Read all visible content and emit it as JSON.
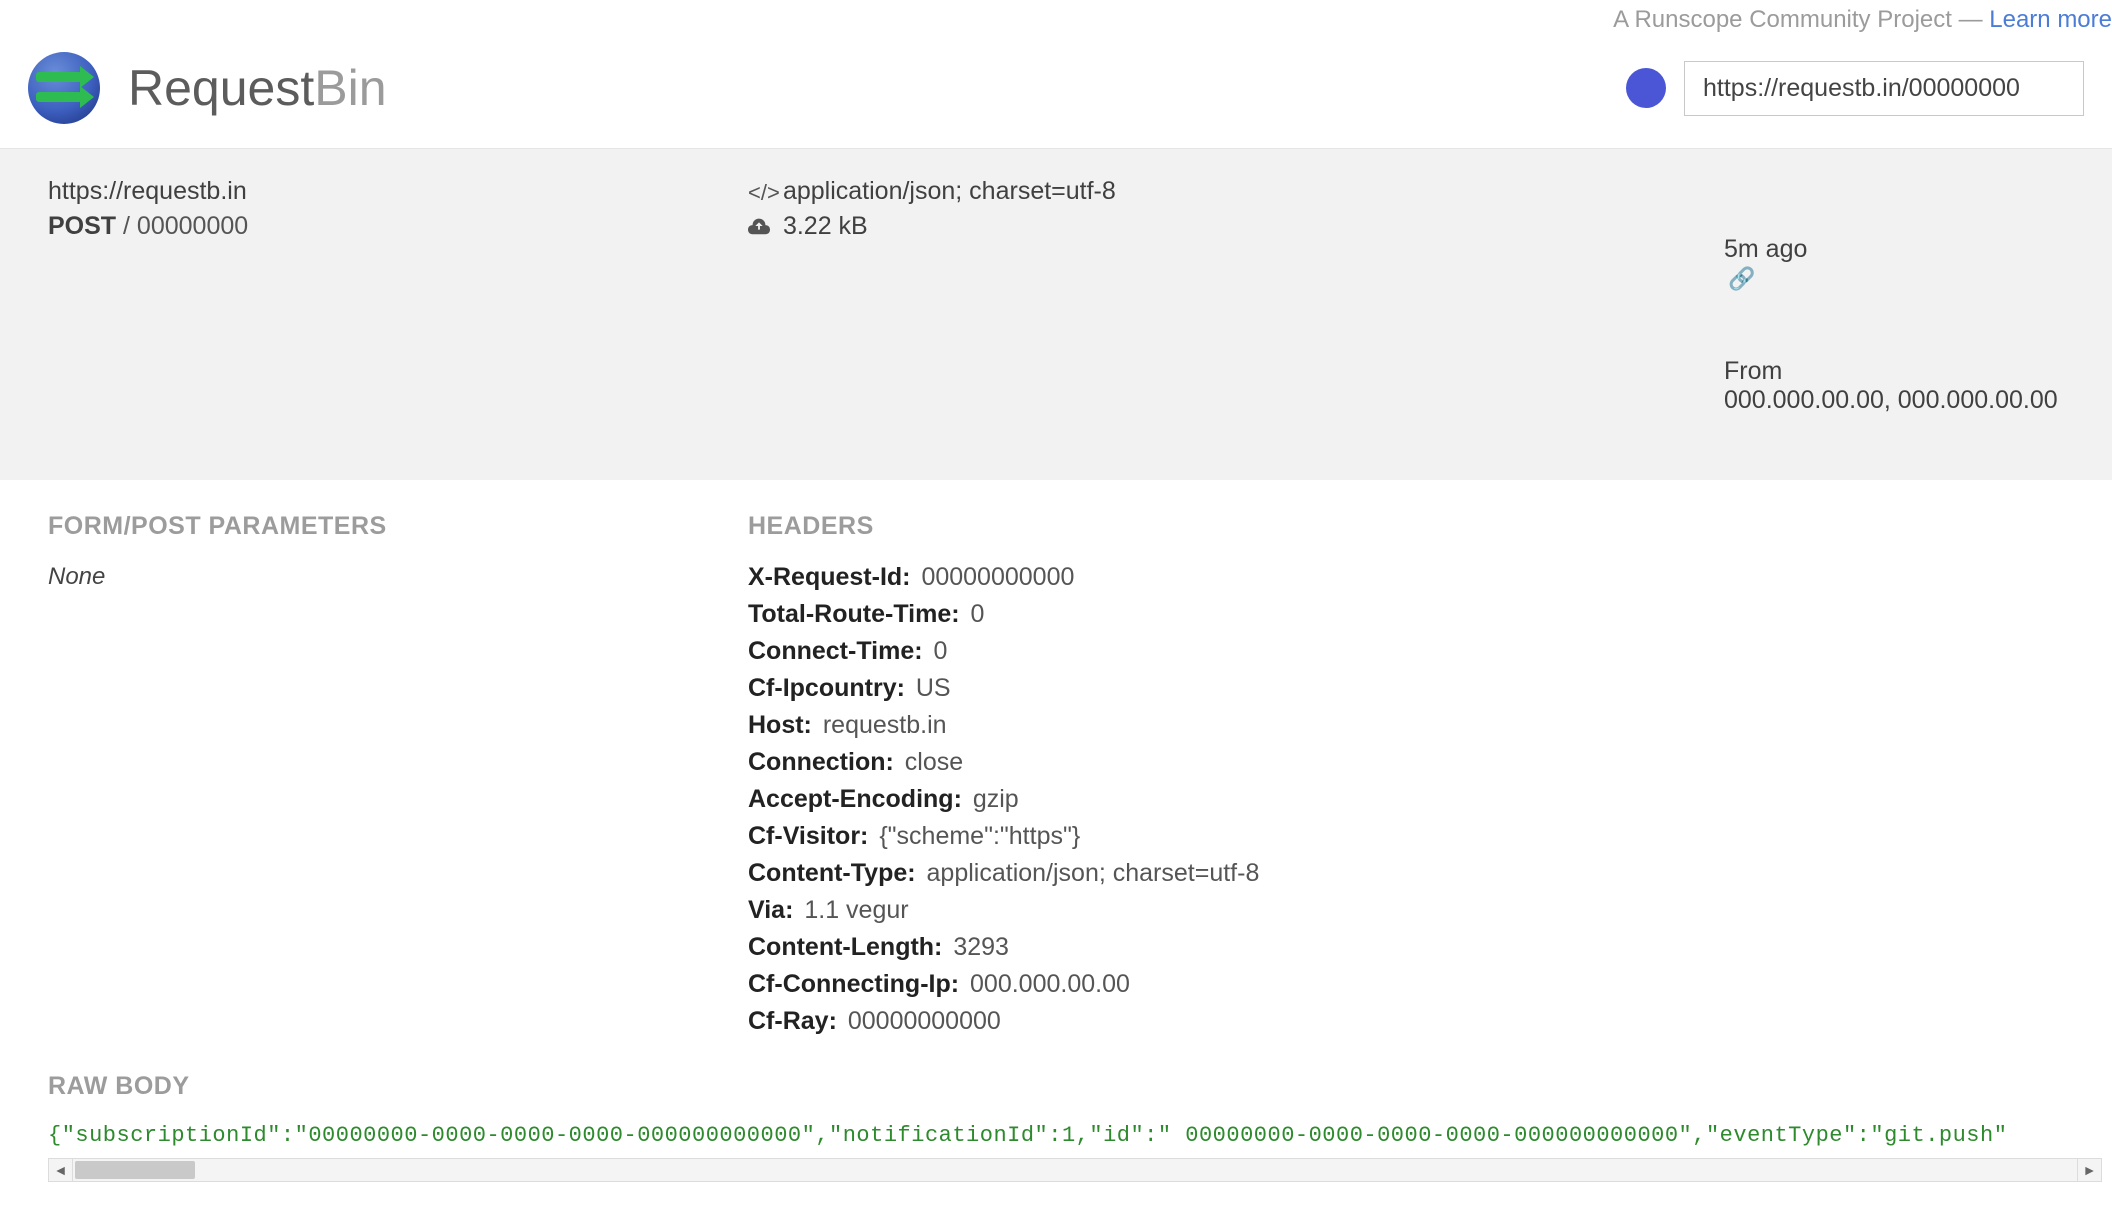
{
  "topbar": {
    "note": "A Runscope Community Project — ",
    "learn_more": "Learn more"
  },
  "brand": {
    "strong": "Request",
    "light": "Bin"
  },
  "bin_url_input": "https://requestb.in/00000000",
  "summary": {
    "host_url": "https://requestb.in",
    "method": "POST",
    "path": "/ 00000000",
    "content_type_line": "application/json; charset=utf-8",
    "size_line": "3.22 kB",
    "time_ago": "5m ago",
    "from_label": "From",
    "from_ips": "000.000.00.00, 000.000.00.00"
  },
  "sections": {
    "form_params_title": "FORM/POST PARAMETERS",
    "form_params_none": "None",
    "headers_title": "HEADERS",
    "raw_body_title": "RAW BODY"
  },
  "headers": [
    {
      "k": "X-Request-Id:",
      "v": "00000000000"
    },
    {
      "k": "Total-Route-Time:",
      "v": "0"
    },
    {
      "k": "Connect-Time:",
      "v": "0"
    },
    {
      "k": "Cf-Ipcountry:",
      "v": "US"
    },
    {
      "k": "Host:",
      "v": "requestb.in"
    },
    {
      "k": "Connection:",
      "v": "close"
    },
    {
      "k": "Accept-Encoding:",
      "v": "gzip"
    },
    {
      "k": "Cf-Visitor:",
      "v": "{\"scheme\":\"https\"}"
    },
    {
      "k": "Content-Type:",
      "v": "application/json; charset=utf-8"
    },
    {
      "k": "Via:",
      "v": "1.1 vegur"
    },
    {
      "k": "Content-Length:",
      "v": "3293"
    },
    {
      "k": "Cf-Connecting-Ip:",
      "v": "000.000.00.00"
    },
    {
      "k": "Cf-Ray:",
      "v": "00000000000"
    }
  ],
  "raw_body": "{\"subscriptionId\":\"00000000-0000-0000-0000-000000000000\",\"notificationId\":1,\"id\":\" 00000000-0000-0000-0000-000000000000\",\"eventType\":\"git.push\""
}
